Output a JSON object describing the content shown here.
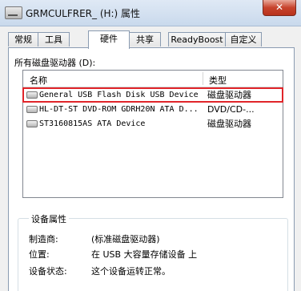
{
  "window": {
    "title": "GRMCULFRER_ (H:) 属性",
    "close_label": "✕"
  },
  "tabs": [
    {
      "label": "常规"
    },
    {
      "label": "工具"
    },
    {
      "label": "硬件"
    },
    {
      "label": "共享"
    },
    {
      "label": "ReadyBoost"
    },
    {
      "label": "自定义"
    }
  ],
  "active_tab": "硬件",
  "hardware": {
    "drives_label": "所有磁盘驱动器 (D):",
    "columns": {
      "name": "名称",
      "type": "类型"
    },
    "devices": [
      {
        "name": "General USB Flash Disk USB Device",
        "type": "磁盘驱动器"
      },
      {
        "name": "HL-DT-ST DVD-ROM GDRH20N ATA D...",
        "type": "DVD/CD-..."
      },
      {
        "name": "ST3160815AS ATA Device",
        "type": "磁盘驱动器"
      }
    ],
    "highlight_color": "#e0252a"
  },
  "properties": {
    "title": "设备属性",
    "manufacturer_label": "制造商:",
    "manufacturer_value": "(标准磁盘驱动器)",
    "location_label": "位置:",
    "location_value": "在 USB 大容量存储设备 上",
    "status_label": "设备状态:",
    "status_value": "这个设备运转正常。"
  }
}
